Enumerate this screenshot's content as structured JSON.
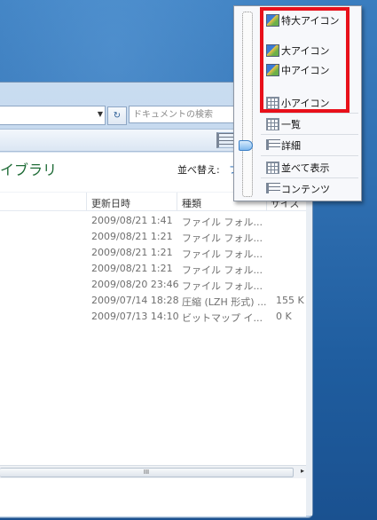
{
  "address": {
    "search_placeholder": "ドキュメントの検索"
  },
  "library": {
    "title": "イブラリ",
    "sort_label": "並べ替え:",
    "sort_value": "フ"
  },
  "columns": {
    "modified": "更新日時",
    "type": "種類",
    "size": "サイズ"
  },
  "rows": [
    {
      "date": "2009/08/21 1:41",
      "type": "ファイル フォル...",
      "size": ""
    },
    {
      "date": "2009/08/21 1:21",
      "type": "ファイル フォル...",
      "size": ""
    },
    {
      "date": "2009/08/21 1:21",
      "type": "ファイル フォル...",
      "size": ""
    },
    {
      "date": "2009/08/21 1:21",
      "type": "ファイル フォル...",
      "size": ""
    },
    {
      "date": "2009/08/20 23:46",
      "type": "ファイル フォル...",
      "size": ""
    },
    {
      "date": "2009/07/14 18:28",
      "type": "圧縮 (LZH 形式) ...",
      "size": "155 K"
    },
    {
      "date": "2009/07/13 14:10",
      "type": "ビットマップ イ...",
      "size": "0 K"
    }
  ],
  "scrollbar": {
    "grip": "III"
  },
  "view_menu": {
    "items": [
      {
        "label": "特大アイコン",
        "icon": "extra-large-icons-icon"
      },
      {
        "label": "大アイコン",
        "icon": "large-icons-icon"
      },
      {
        "label": "中アイコン",
        "icon": "medium-icons-icon"
      },
      {
        "label": "小アイコン",
        "icon": "small-icons-icon"
      },
      {
        "label": "一覧",
        "icon": "list-view-icon"
      },
      {
        "label": "詳細",
        "icon": "details-view-icon"
      },
      {
        "label": "並べて表示",
        "icon": "tiles-view-icon"
      },
      {
        "label": "コンテンツ",
        "icon": "content-view-icon"
      }
    ],
    "highlight_color": "#e8101a"
  }
}
